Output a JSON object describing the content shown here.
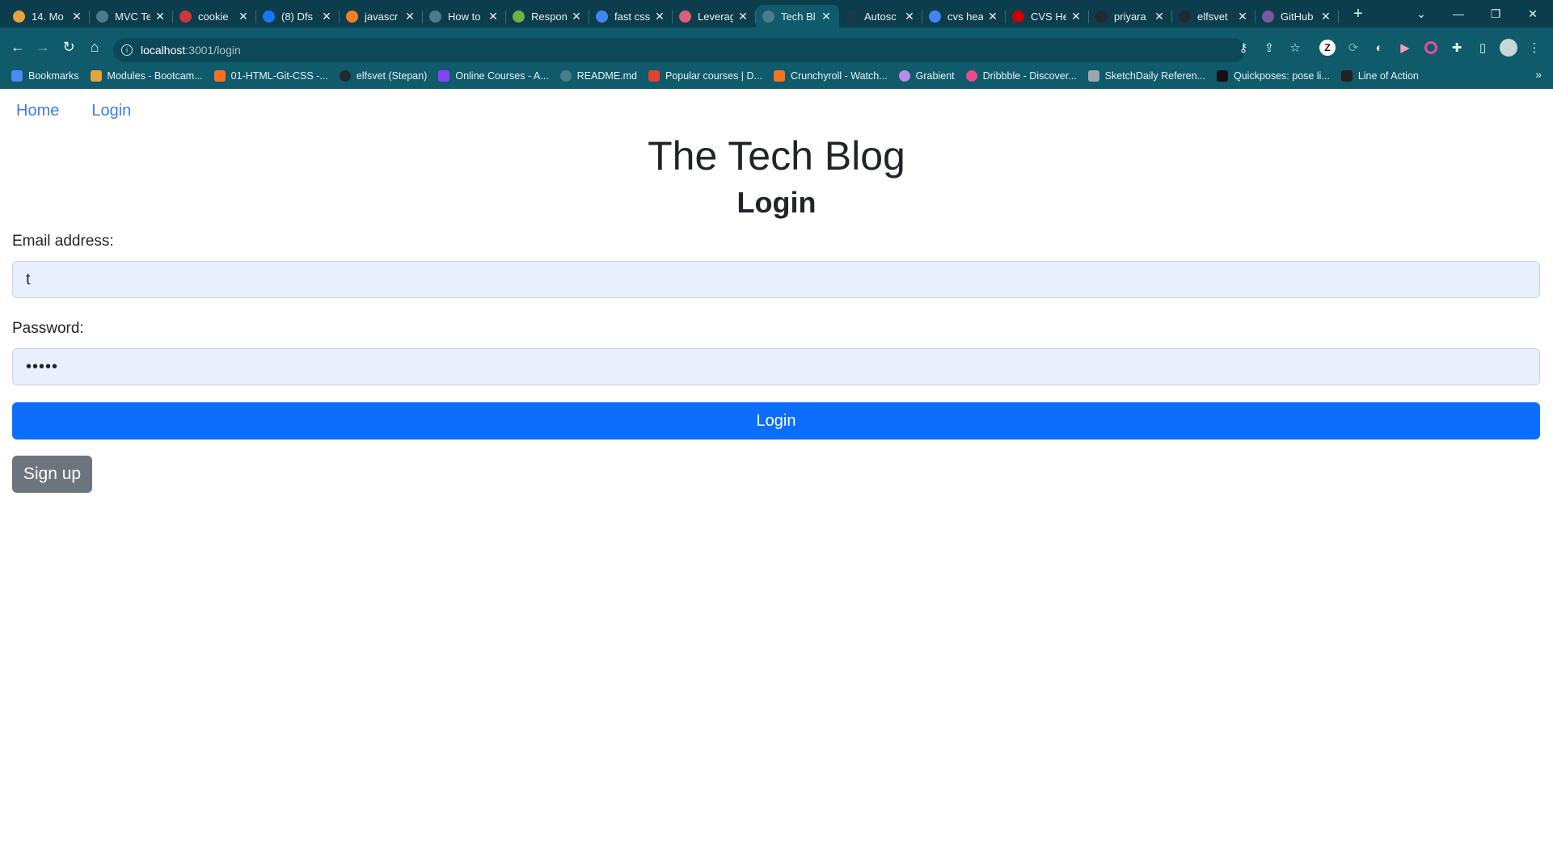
{
  "browser": {
    "tabs": [
      {
        "title": "14. Mo",
        "icon": "udemy-icon",
        "color": "#e8a33d",
        "active": false
      },
      {
        "title": "MVC Te",
        "icon": "globe-icon",
        "color": "#4a7c8a",
        "active": false
      },
      {
        "title": "cookie",
        "icon": "npm-icon",
        "color": "#cb3837",
        "active": false
      },
      {
        "title": "(8) Dfs",
        "icon": "facebook-icon",
        "color": "#1877f2",
        "active": false
      },
      {
        "title": "javascr",
        "icon": "stackoverflow-icon",
        "color": "#f48024",
        "active": false
      },
      {
        "title": "How to",
        "icon": "globe-icon",
        "color": "#4a7c8a",
        "active": false
      },
      {
        "title": "Respon",
        "icon": "leaf-icon",
        "color": "#6db33f",
        "active": false
      },
      {
        "title": "fast css",
        "icon": "google-icon",
        "color": "#4285f4",
        "active": false
      },
      {
        "title": "Leverag",
        "icon": "brain-icon",
        "color": "#e05d77",
        "active": false
      },
      {
        "title": "Tech Bl",
        "icon": "globe-icon",
        "color": "#4a7c8a",
        "active": true
      },
      {
        "title": "Autosc",
        "icon": "circle-icon",
        "color": "#1e3a4a",
        "active": false
      },
      {
        "title": "cvs hea",
        "icon": "google-icon",
        "color": "#4285f4",
        "active": false
      },
      {
        "title": "CVS He",
        "icon": "heart-icon",
        "color": "#cc0000",
        "active": false
      },
      {
        "title": "priyara",
        "icon": "github-icon",
        "color": "#24292f",
        "active": false
      },
      {
        "title": "elfsvet",
        "icon": "github-icon",
        "color": "#24292f",
        "active": false
      },
      {
        "title": "GitHub",
        "icon": "heroku-icon",
        "color": "#79589f",
        "active": false
      }
    ],
    "address": {
      "host": "localhost",
      "rest": ":3001/login"
    },
    "bookmarks": [
      {
        "label": "Bookmarks",
        "icon": "star-icon",
        "color": "#4c8bf5"
      },
      {
        "label": "Modules - Bootcam...",
        "icon": "udemy-icon",
        "color": "#e8a33d"
      },
      {
        "label": "01-HTML-Git-CSS -...",
        "icon": "gitlab-icon",
        "color": "#fc6d26"
      },
      {
        "label": "elfsvet (Stepan)",
        "icon": "github-icon",
        "color": "#24292f"
      },
      {
        "label": "Online Courses - A...",
        "icon": "shield-icon",
        "color": "#8a3ffc"
      },
      {
        "label": "README.md",
        "icon": "globe-icon",
        "color": "#4a7c8a"
      },
      {
        "label": "Popular courses | D...",
        "icon": "heart-icon",
        "color": "#e0442e"
      },
      {
        "label": "Crunchyroll - Watch...",
        "icon": "crunchyroll-icon",
        "color": "#f47521"
      },
      {
        "label": "Grabient",
        "icon": "gradient-icon",
        "color": "#b78ce8"
      },
      {
        "label": "Dribbble - Discover...",
        "icon": "dribbble-icon",
        "color": "#ea4c89"
      },
      {
        "label": "SketchDaily Referen...",
        "icon": "sketch-icon",
        "color": "#9aa7ad"
      },
      {
        "label": "Quickposes: pose li...",
        "icon": "qp-icon",
        "color": "#111111"
      },
      {
        "label": "Line of Action",
        "icon": "figure-icon",
        "color": "#222222"
      }
    ]
  },
  "nav": {
    "home": "Home",
    "login": "Login"
  },
  "header": {
    "title": "The Tech Blog",
    "subtitle": "Login"
  },
  "form": {
    "email_label": "Email address:",
    "email_value": "t",
    "password_label": "Password:",
    "password_value": "•••••",
    "login_button": "Login",
    "signup_button": "Sign up"
  },
  "colors": {
    "link": "#3d7ee9",
    "primary": "#0d6efd",
    "secondary": "#6c757d",
    "input_bg": "#e8f0fe",
    "chrome_dark": "#0c3d4c",
    "chrome": "#0f5a6b"
  }
}
